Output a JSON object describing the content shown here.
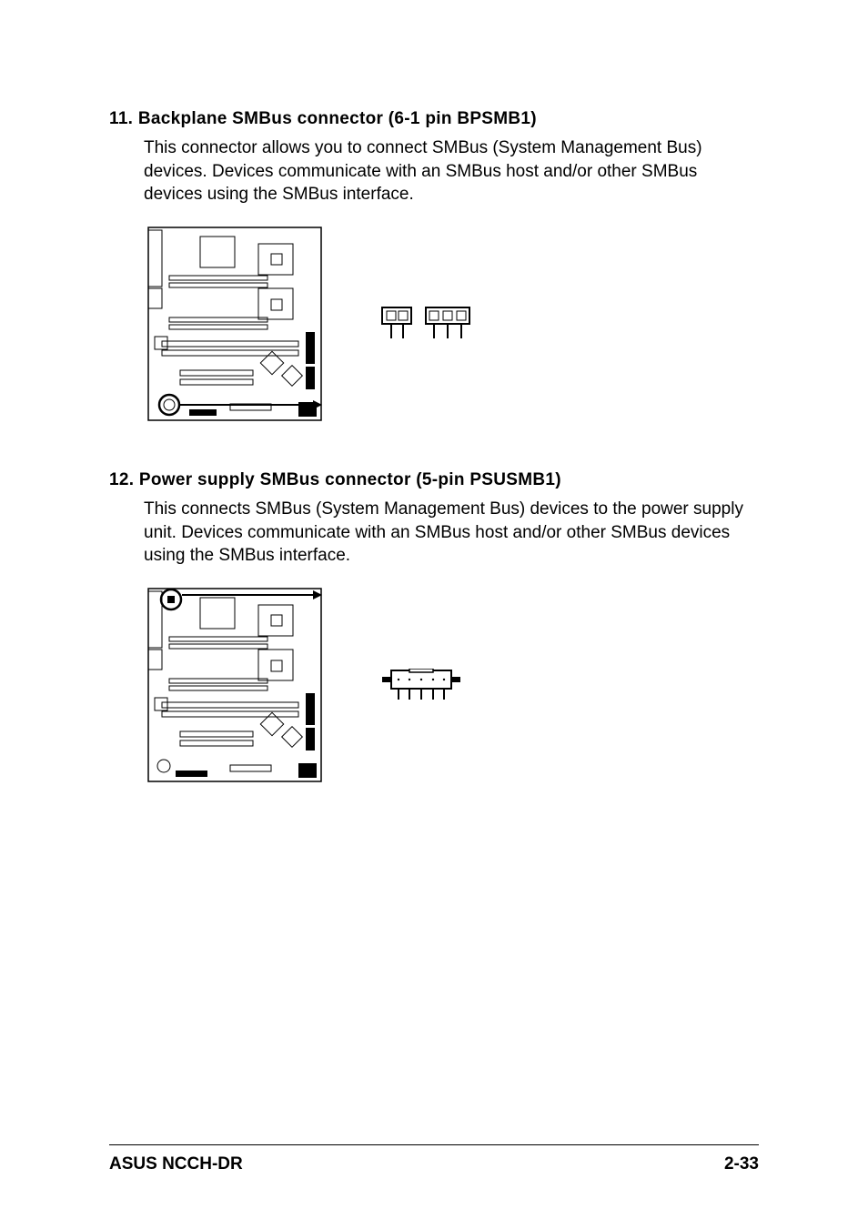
{
  "sections": [
    {
      "num": "11.",
      "title": "Backplane SMBus connector (6-1 pin BPSMB1)",
      "body": "This connector allows you to connect SMBus (System Management Bus) devices. Devices communicate with an SMBus host and/or other SMBus devices using the SMBus interface."
    },
    {
      "num": "12.",
      "title": "Power supply SMBus connector (5-pin PSUSMB1)",
      "body": "This connects SMBus (System Management Bus) devices to the power supply unit. Devices communicate with an SMBus host and/or other SMBus devices using the SMBus interface."
    }
  ],
  "footer": {
    "left": "ASUS NCCH-DR",
    "right": "2-33"
  }
}
